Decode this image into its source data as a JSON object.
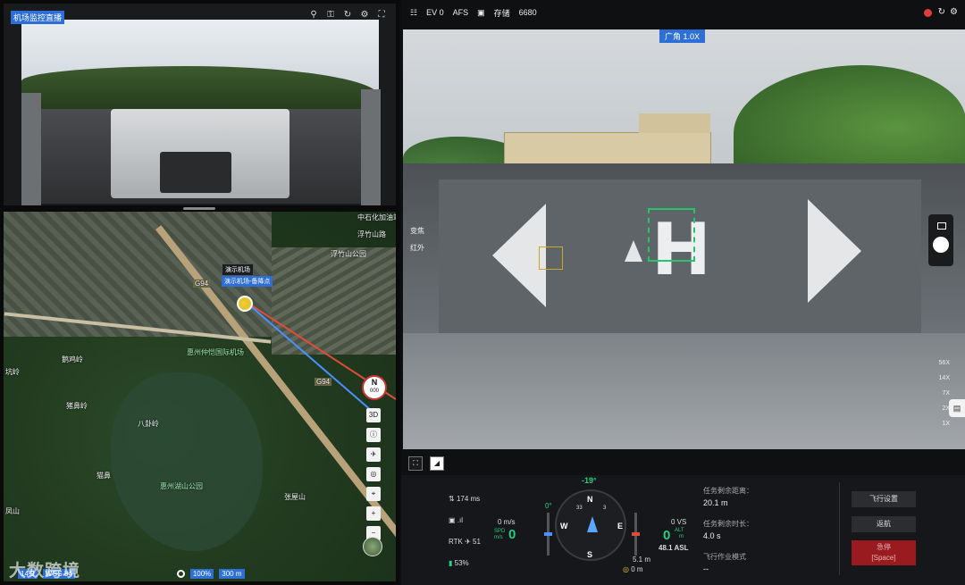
{
  "left_cam": {
    "title": "机场监控直播",
    "icons": [
      "pin-icon",
      "lock-icon",
      "refresh-icon",
      "settings-icon",
      "fullscreen-icon"
    ]
  },
  "map": {
    "labels": [
      {
        "text": "中石化加油站",
        "kind": "plain"
      },
      {
        "text": "浮竹山路",
        "kind": "plain"
      },
      {
        "text": "浮竹山公园",
        "kind": "plain"
      },
      {
        "text": "鹅鸡岭",
        "kind": "plain"
      },
      {
        "text": "猪鼻岭",
        "kind": "plain"
      },
      {
        "text": "八卦岭",
        "kind": "plain"
      },
      {
        "text": "猫鼻",
        "kind": "plain"
      },
      {
        "text": "张屋山",
        "kind": "plain"
      },
      {
        "text": "凤山",
        "kind": "plain"
      },
      {
        "text": "坑岭",
        "kind": "plain"
      },
      {
        "text": "惠州仲恺国际机场",
        "kind": "poi"
      },
      {
        "text": "惠州湖山公园",
        "kind": "poi"
      },
      {
        "text": "G94",
        "kind": "plain"
      },
      {
        "text": "G94",
        "kind": "plain"
      }
    ],
    "tag_dock": "演示机场",
    "tag_point": "演示机场-备降点",
    "compass": {
      "dir": "N",
      "value": "000"
    },
    "tools": [
      "3D",
      "info",
      "plane",
      "locate",
      "route",
      "+",
      "−"
    ],
    "footer": {
      "zoom": "14.9",
      "coord": "WGS 84",
      "scale_pct": "100%",
      "scale": "300 m"
    }
  },
  "watermark": "大数跨境",
  "topbar": {
    "ev": "EV 0",
    "afs": "AFS",
    "storage_label": "存储",
    "storage": "6680"
  },
  "view": {
    "zoom_tag": "广角 1.0X",
    "side_labels": [
      "变焦",
      "红外"
    ],
    "zoom_scale": [
      "56X",
      "14X",
      "7X",
      "2X",
      "1X"
    ]
  },
  "telemetry": {
    "latency": "174 ms",
    "rtk": "RTK",
    "rtk_count": "51",
    "battery": "53%",
    "spd_label": "SPD",
    "spd_unit": "m/s",
    "spd_top": "0 m/s",
    "spd": "0",
    "heading": "-19°",
    "left_pitch": "0°",
    "vs": "0 VS",
    "alt": "0",
    "alt_label": "ALT",
    "alt_unit": "m",
    "asl": "48.1 ASL",
    "h1": "5.1 m",
    "h2": "0 m",
    "compass": {
      "n": "N",
      "e": "E",
      "s": "S",
      "w": "W",
      "a": "33",
      "b": "3"
    }
  },
  "task": {
    "dist_label": "任务剩余距离：",
    "dist": "20.1 m",
    "time_label": "任务剩余时长：",
    "time": "4.0 s",
    "mode_label": "飞行作业模式",
    "mode": "--"
  },
  "actions": {
    "flight_settings": "飞行设置",
    "return": "返航",
    "stop": "急停",
    "stop_hint": "[Space]"
  },
  "colors": {
    "accent": "#2d6fd6",
    "ok": "#22d082",
    "danger": "#9a1b1f",
    "record": "#e53a3a"
  }
}
